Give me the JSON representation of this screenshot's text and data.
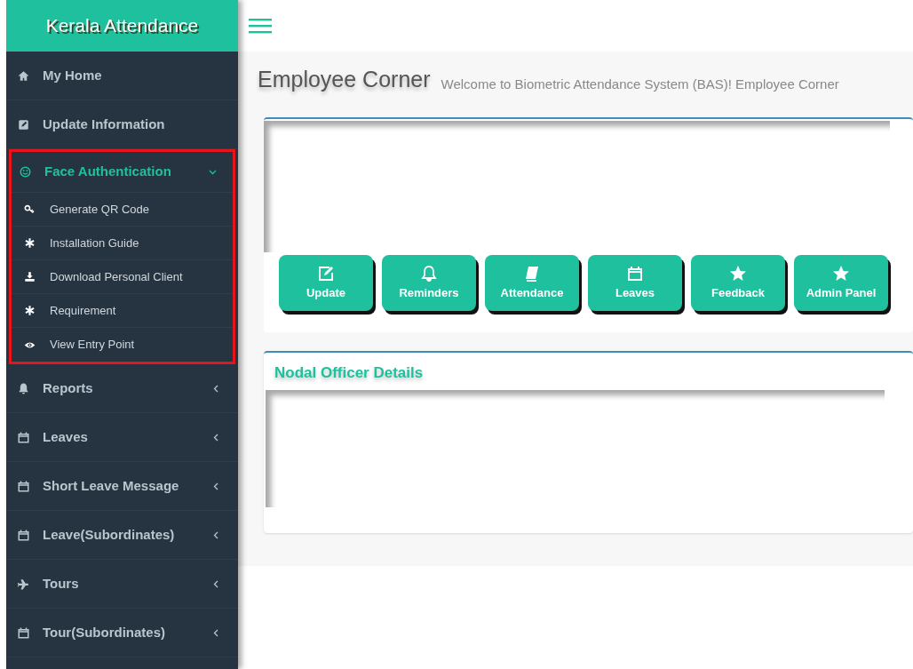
{
  "brand": "Kerala Attendance",
  "sidebar": {
    "items": [
      {
        "label": "My Home",
        "kind": "link"
      },
      {
        "label": "Update Information",
        "kind": "link"
      },
      {
        "label": "Face Authentication",
        "kind": "menu",
        "expanded": true,
        "highlighted": true,
        "children": [
          {
            "label": "Generate QR Code"
          },
          {
            "label": "Installation Guide"
          },
          {
            "label": "Download Personal Client"
          },
          {
            "label": "Requirement"
          },
          {
            "label": "View Entry Point"
          }
        ]
      },
      {
        "label": "Reports",
        "kind": "menu",
        "expanded": false,
        "highlighted": false
      },
      {
        "label": "Leaves",
        "kind": "menu",
        "expanded": false,
        "highlighted": false
      },
      {
        "label": "Short Leave Message",
        "kind": "menu",
        "expanded": false,
        "highlighted": false
      },
      {
        "label": "Leave(Subordinates)",
        "kind": "menu",
        "expanded": false,
        "highlighted": false
      },
      {
        "label": "Tours",
        "kind": "menu",
        "expanded": false,
        "highlighted": false
      },
      {
        "label": "Tour(Subordinates)",
        "kind": "menu",
        "expanded": false,
        "highlighted": false
      }
    ]
  },
  "page": {
    "title": "Employee Corner",
    "subtitle": "Welcome to Biometric Attendance System (BAS)! Employee Corner"
  },
  "buttons": [
    "Update",
    "Reminders",
    "Attendance",
    "Leaves",
    "Feedback",
    "Admin Panel"
  ],
  "nodal": {
    "title": "Nodal Officer Details"
  }
}
